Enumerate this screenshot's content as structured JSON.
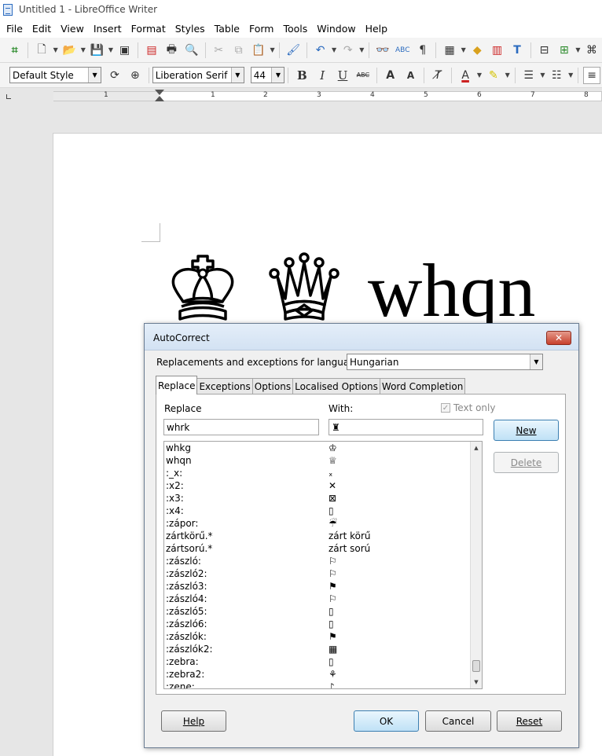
{
  "window": {
    "title": "Untitled 1 - LibreOffice Writer"
  },
  "menu": [
    "File",
    "Edit",
    "View",
    "Insert",
    "Format",
    "Styles",
    "Table",
    "Form",
    "Tools",
    "Window",
    "Help"
  ],
  "toolbar": {
    "paragraph_style": "Default Style",
    "font_name": "Liberation Serif",
    "font_size": "44",
    "bold_label": "B",
    "italic_label": "I",
    "underline_label": "U",
    "strike_label": "ABC"
  },
  "ruler": {
    "numbers": [
      "1",
      "1",
      "2",
      "3",
      "4",
      "5",
      "6",
      "7",
      "8"
    ]
  },
  "document": {
    "text": "whqn",
    "symbols": [
      "white-king",
      "white-queen"
    ]
  },
  "dialog": {
    "title": "AutoCorrect",
    "close": "✕",
    "language_label": "Replacements and exceptions for language:",
    "language_value": "Hungarian",
    "tabs": [
      "Replace",
      "Exceptions",
      "Options",
      "Localised Options",
      "Word Completion"
    ],
    "replace_header": "Replace",
    "with_header": "With:",
    "text_only_label": "Text only",
    "replace_value": "whrk",
    "with_value": "♜",
    "entries": [
      {
        "key": "whkg",
        "value": "♔"
      },
      {
        "key": "whqn",
        "value": "♕"
      },
      {
        "key": ":_x:",
        "value": "ₓ"
      },
      {
        "key": ":x2:",
        "value": "✕"
      },
      {
        "key": ":x3:",
        "value": "⊠"
      },
      {
        "key": ":x4:",
        "value": "▯"
      },
      {
        "key": ":zápor:",
        "value": "☔"
      },
      {
        "key": "zártkörű.*",
        "value": "zárt körű"
      },
      {
        "key": "zártsorú.*",
        "value": "zárt sorú"
      },
      {
        "key": ":zászló:",
        "value": "⚐"
      },
      {
        "key": ":zászló2:",
        "value": "⚐"
      },
      {
        "key": ":zászló3:",
        "value": "⚑"
      },
      {
        "key": ":zászló4:",
        "value": "⚐"
      },
      {
        "key": ":zászló5:",
        "value": "▯"
      },
      {
        "key": ":zászló6:",
        "value": "▯"
      },
      {
        "key": ":zászlók:",
        "value": "⚑"
      },
      {
        "key": ":zászlók2:",
        "value": "▦"
      },
      {
        "key": ":zebra:",
        "value": "▯"
      },
      {
        "key": ":zebra2:",
        "value": "⚘"
      },
      {
        "key": ":zene:",
        "value": "♪"
      }
    ],
    "buttons": {
      "new": "New",
      "delete": "Delete",
      "help": "Help",
      "ok": "OK",
      "cancel": "Cancel",
      "reset": "Reset"
    }
  }
}
